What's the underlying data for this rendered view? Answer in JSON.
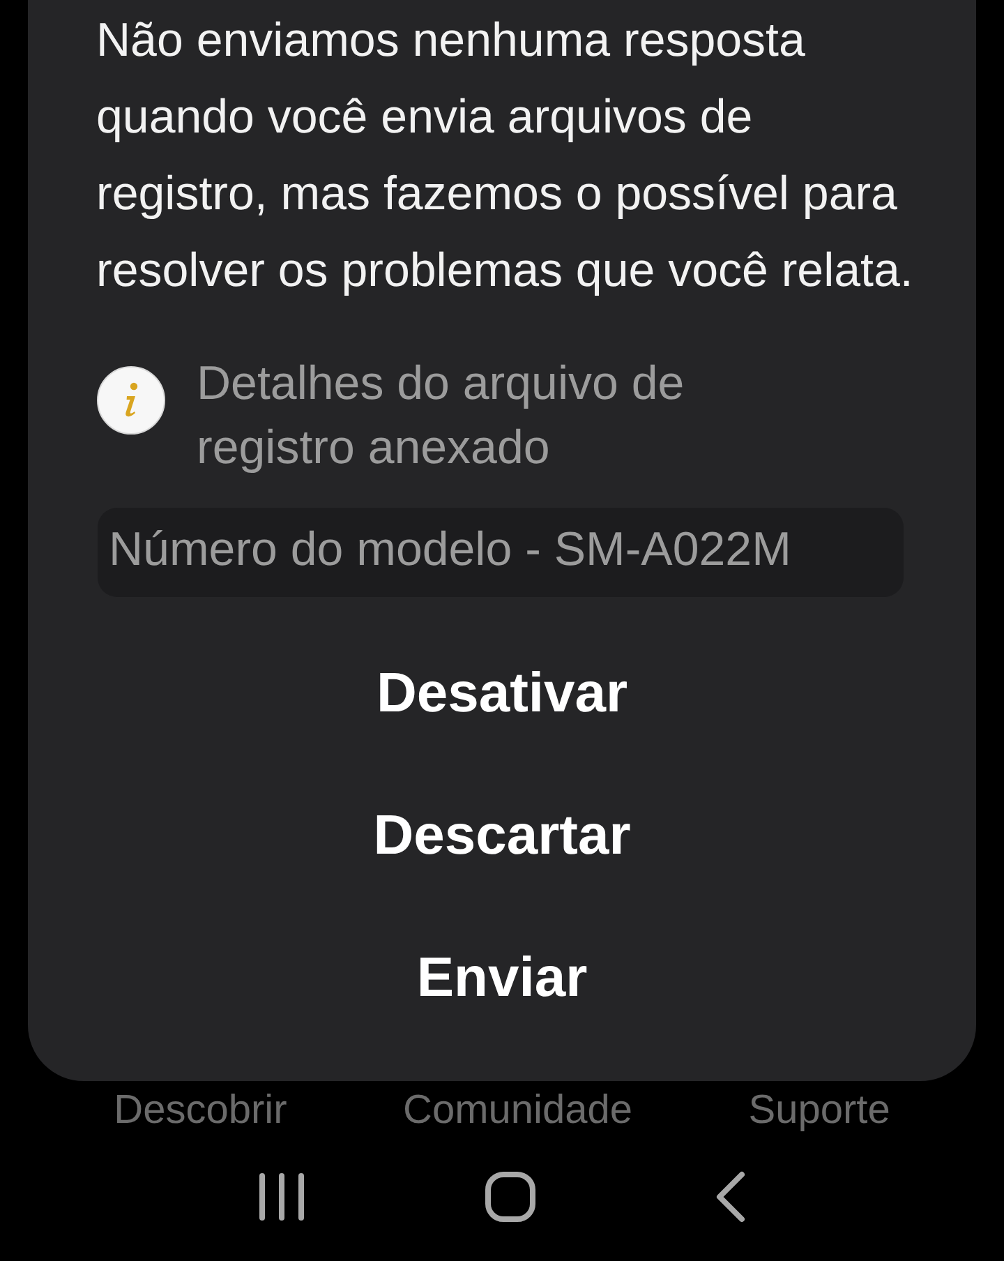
{
  "message": "Não enviamos nenhuma resposta quando você envia arquivos de registro, mas fazemos o possível para resolver os problemas que você relata.",
  "info": {
    "title": "Detalhes do arquivo de registro anexado"
  },
  "details": [
    {
      "text": "Número do modelo - SM-A022M"
    }
  ],
  "actions": [
    "Desativar",
    "Descartar",
    "Enviar"
  ],
  "bottom_tabs": [
    {
      "label": "Descobrir"
    },
    {
      "label": "Comunidade"
    },
    {
      "label": "Suporte"
    }
  ]
}
